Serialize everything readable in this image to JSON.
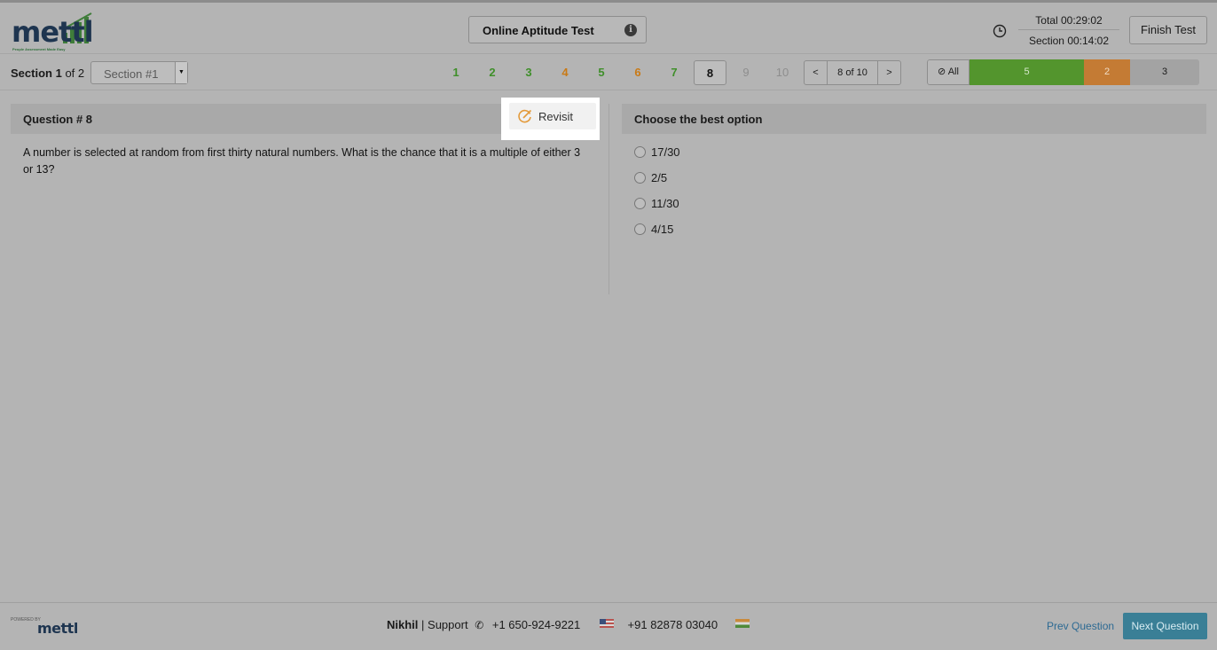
{
  "brand": {
    "name": "mettl",
    "tagline": "People Assessment Made Easy",
    "powered_by": "POWERED BY"
  },
  "header": {
    "title": "Online Aptitude Test",
    "timer_total": "Total 00:29:02",
    "timer_section": "Section 00:14:02",
    "finish_button": "Finish Test"
  },
  "section_bar": {
    "section_prefix": "Section",
    "section_current": "1",
    "section_suffix": "of 2",
    "section_select": "Section #1",
    "questions": [
      {
        "label": "1",
        "state": "answered"
      },
      {
        "label": "2",
        "state": "answered"
      },
      {
        "label": "3",
        "state": "answered"
      },
      {
        "label": "4",
        "state": "revisit"
      },
      {
        "label": "5",
        "state": "answered"
      },
      {
        "label": "6",
        "state": "revisit"
      },
      {
        "label": "7",
        "state": "answered"
      },
      {
        "label": "8",
        "state": "current"
      },
      {
        "label": "9",
        "state": "unvisited"
      },
      {
        "label": "10",
        "state": "unvisited"
      }
    ],
    "pager": {
      "prev": "<",
      "text": "8 of 10",
      "next": ">"
    },
    "status": {
      "all_label": "All",
      "answered": "5",
      "revisit": "2",
      "unanswered": "3"
    }
  },
  "question": {
    "title": "Question # 8",
    "revisit_label": "Revisit",
    "text": "A number is selected at random from first thirty natural numbers. What is the chance that it is a multiple of either 3 or 13?"
  },
  "options": {
    "title": "Choose the best option",
    "items": [
      "17/30",
      "2/5",
      "11/30",
      "4/15"
    ]
  },
  "footer": {
    "user": "Nikhil",
    "support_label": "| Support",
    "phone_us": "+1 650-924-9221",
    "phone_in": "+91 82878 03040",
    "prev_button": "Prev Question",
    "next_button": "Next Question"
  },
  "colors": {
    "answered": "#53952d",
    "revisit": "#c47b34",
    "primary": "#3a7f96"
  }
}
